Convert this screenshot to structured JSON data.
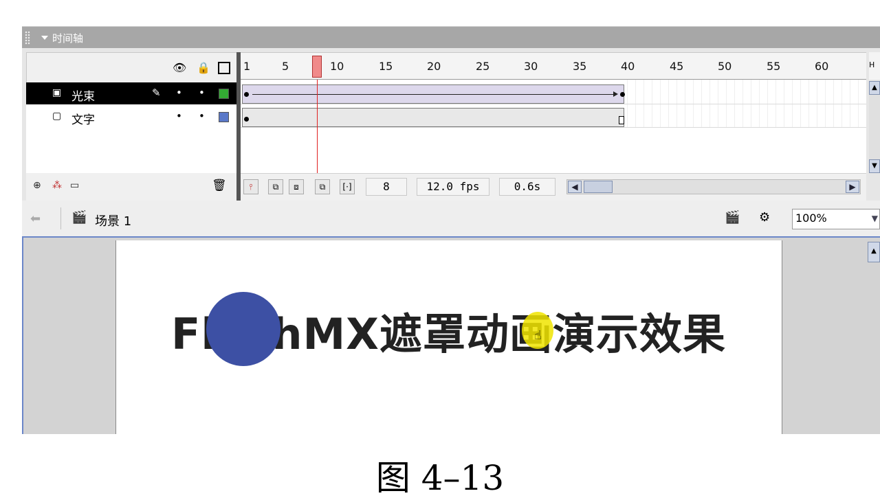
{
  "panel": {
    "title": "时间轴"
  },
  "timeline": {
    "header_icons": [
      "eye-icon",
      "lock-icon",
      "outline-icon"
    ],
    "layers": [
      {
        "name": "光束",
        "selected": true,
        "color": "#33aa33"
      },
      {
        "name": "文字",
        "selected": false,
        "color": "#5a78c8"
      }
    ],
    "ruler_labels": [
      "1",
      "5",
      "10",
      "15",
      "20",
      "25",
      "30",
      "35",
      "40",
      "45",
      "50",
      "55",
      "60"
    ],
    "ruler_end_label": "H",
    "current_frame": "8",
    "fps": "12.0 fps",
    "elapsed": "0.6s"
  },
  "editbar": {
    "scene": "场景 1",
    "zoom": "100%"
  },
  "stage": {
    "text": "FlashMX遮罩动画演示效果",
    "circle_color": "#3d50a4",
    "highlight_color": "#f0e400"
  },
  "caption": "图 4–13"
}
